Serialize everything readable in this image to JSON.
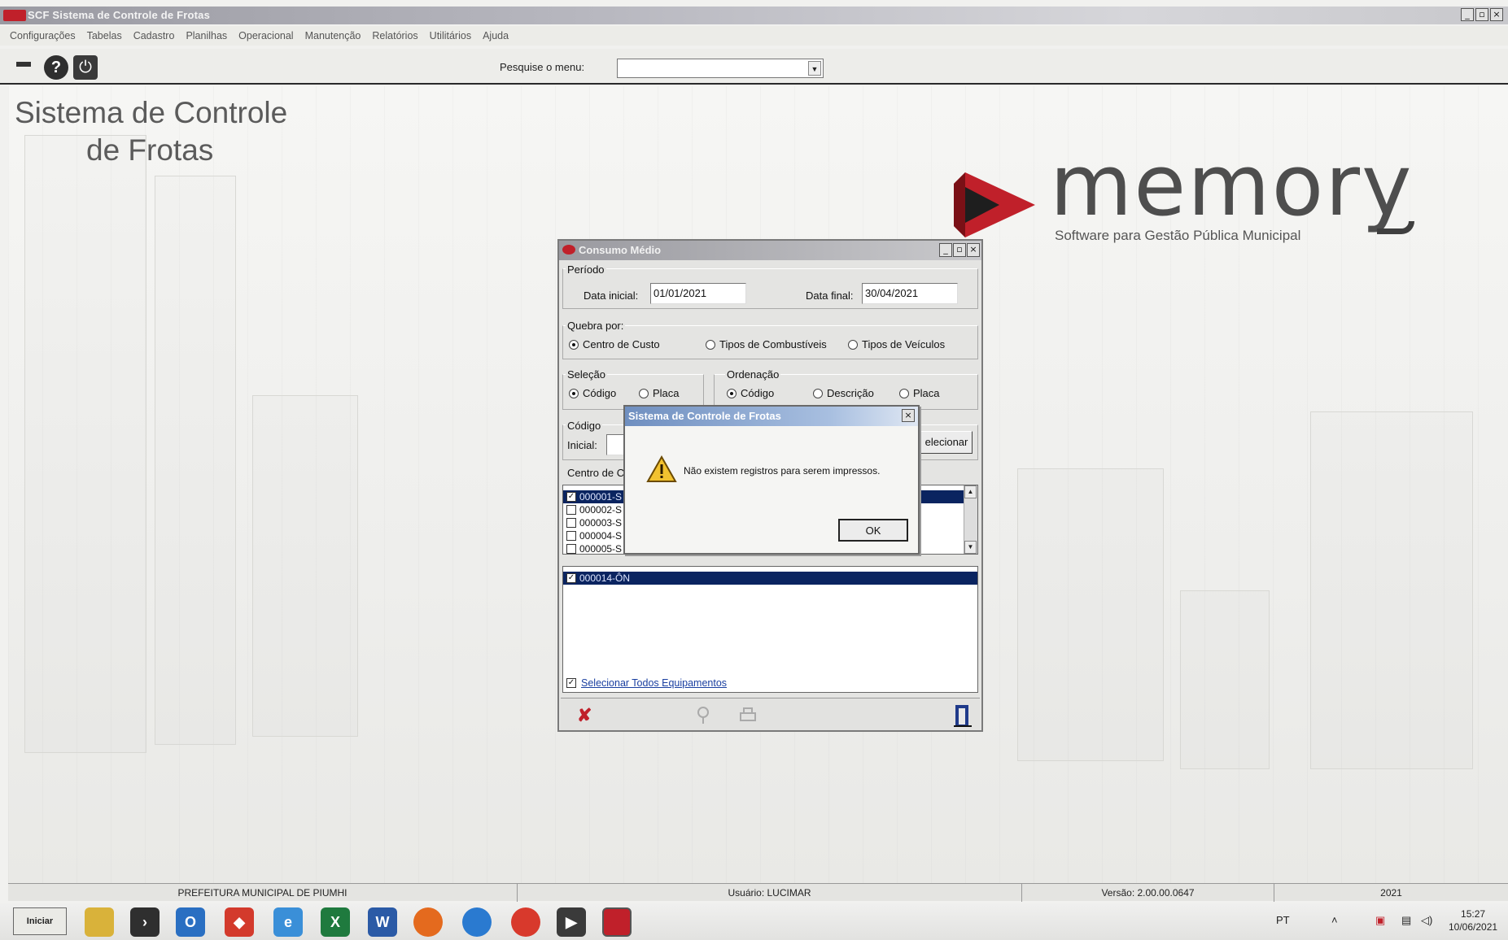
{
  "window": {
    "title": "SCF Sistema de Controle de Frotas",
    "min": "_",
    "max": "▫",
    "close": "×"
  },
  "menu": [
    "Configurações",
    "Tabelas",
    "Cadastro",
    "Planilhas",
    "Operacional",
    "Manutenção",
    "Relatórios",
    "Utilitários",
    "Ajuda"
  ],
  "toolbar": {
    "help_glyph": "?",
    "power_glyph": "⏻",
    "search_label": "Pesquise o menu:",
    "search_value": "",
    "dropdown_glyph": "▼"
  },
  "desktop": {
    "title_line1": "Sistema de Controle",
    "title_line2": "de Frotas",
    "logo_word": "memory",
    "logo_sub": "Software para Gestão Pública Municipal"
  },
  "consumo": {
    "title": "Consumo Médio",
    "periodo_label": "Período",
    "data_inicial_label": "Data inicial:",
    "data_inicial": "01/01/2021",
    "data_final_label": "Data final:",
    "data_final": "30/04/2021",
    "quebra_label": "Quebra por:",
    "quebra_opts": [
      "Centro de Custo",
      "Tipos de Combustíveis",
      "Tipos de Veículos"
    ],
    "selecao_label": "Seleção",
    "selecao_opts": [
      "Código",
      "Placa"
    ],
    "ordenacao_label": "Ordenação",
    "ordenacao_opts": [
      "Código",
      "Descrição",
      "Placa"
    ],
    "codigo_label": "Código",
    "inicial_label": "Inicial:",
    "selecionar_btn": "elecionar",
    "centro_label": "Centro de Cu",
    "centros": [
      "000001-S",
      "000002-S",
      "000003-S",
      "000004-S",
      "000005-S"
    ],
    "equipamento": "000014-ÔN",
    "selecionar_todos": "Selecionar Todos Equipamentos",
    "cancel_glyph": "✘",
    "scroll_up": "▲",
    "scroll_down": "▼",
    "check_glyph": "✓"
  },
  "dialog": {
    "title": "Sistema de Controle de Frotas",
    "message": "Não existem registros para serem impressos.",
    "ok": "OK",
    "close": "×"
  },
  "status": {
    "org": "PREFEITURA MUNICIPAL DE PIUMHI",
    "user": "Usuário: LUCIMAR",
    "version": "Versão: 2.00.00.0647",
    "year": "2021"
  },
  "taskbar": {
    "start": "Iniciar",
    "lang": "PT",
    "time": "15:27",
    "date": "10/06/2021"
  },
  "colors": {
    "brand_red": "#c0202a",
    "selection_blue": "#0a2460"
  }
}
